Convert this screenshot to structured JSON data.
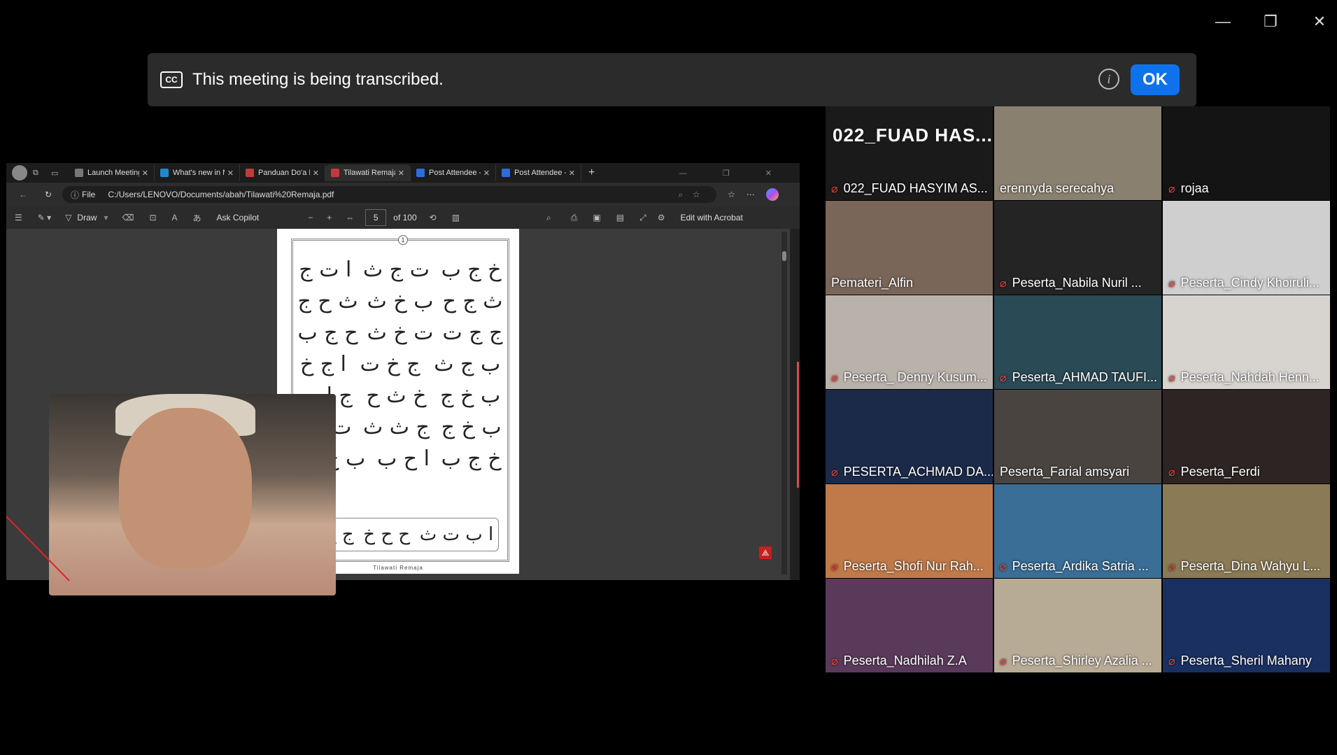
{
  "window": {
    "minimize": "—",
    "restore": "❐",
    "close": "✕"
  },
  "banner": {
    "cc": "CC",
    "text": "This meeting is being transcribed.",
    "info": "i",
    "ok": "OK"
  },
  "browser": {
    "tabs": [
      {
        "label": "Launch Meeting - Zo",
        "color": "#777"
      },
      {
        "label": "What's new in Micro",
        "color": "#1f8ad2"
      },
      {
        "label": "Panduan Do'a Pemb",
        "color": "#c43a3a"
      },
      {
        "label": "Tilawati Remaja.pdf",
        "color": "#c43a3a"
      },
      {
        "label": "Post Attendee - Zoo",
        "color": "#2d6cdf"
      },
      {
        "label": "Post Attendee - Zoo",
        "color": "#2d6cdf"
      }
    ],
    "new_tab": "+",
    "address_prefix": "File",
    "address": "C:/Users/LENOVO/Documents/abah/Tilawati%20Remaja.pdf",
    "pdf_toolbar": {
      "draw": "Draw",
      "ask_copilot": "Ask Copilot",
      "page": "5",
      "page_total": "of 100",
      "edit_acrobat": "Edit with Acrobat"
    },
    "page_number_badge": "1",
    "arabic_rows": [
      [
        "خ ج ب",
        "ت ج ث",
        "ا ت ج"
      ],
      [
        "ث ج ح",
        "ب خ ث",
        "ث ح ج"
      ],
      [
        "ج ج ت",
        "ت خ ث",
        "ح ج ب"
      ],
      [
        "ب ج ث",
        "ج خ ت",
        "ا ج خ"
      ],
      [
        "ب خ ج",
        "خ ث ح",
        "ج ا ب"
      ],
      [
        "ب خ ج",
        "ج ث ث",
        "ت ا خ"
      ],
      [
        "خ ج ب",
        "ا ح ب",
        "ب ح ث"
      ]
    ],
    "bottom_box": [
      "ا ب ت ث",
      "ح ح خ",
      "ج ح ح"
    ],
    "page_footer": "Tilawati Remaja"
  },
  "gallery": [
    {
      "name": "022_FUAD HASYIM AS...",
      "big": "022_FUAD  HAS...",
      "muted": true,
      "bg": "#1a1a1a"
    },
    {
      "name": "erennyda serecahya",
      "muted": false,
      "bg": "#8a8070"
    },
    {
      "name": "rojaa",
      "muted": true,
      "bg": "#141414"
    },
    {
      "name": "Pemateri_Alfin",
      "muted": false,
      "active": true,
      "bg": "#7a6658"
    },
    {
      "name": "Peserta_Nabila Nuril ...",
      "muted": true,
      "bg": "#242424"
    },
    {
      "name": "Peserta_Cindy Khoiruli...",
      "muted": true,
      "bg": "#cfcfcf"
    },
    {
      "name": "Peserta_ Denny Kusum...",
      "muted": true,
      "bg": "#b9b2aa"
    },
    {
      "name": "Peserta_AHMAD TAUFI...",
      "muted": true,
      "bg": "#2a4a55"
    },
    {
      "name": "Peserta_Nahdah Henn...",
      "muted": true,
      "bg": "#d7d4d0"
    },
    {
      "name": "PESERTA_ACHMAD DA...",
      "muted": true,
      "bg": "#1c2a4a"
    },
    {
      "name": "Peserta_Farial amsyari",
      "muted": false,
      "bg": "#4a4440"
    },
    {
      "name": "Peserta_Ferdi",
      "muted": true,
      "bg": "#2e2424"
    },
    {
      "name": "Peserta_Shofi Nur Rah...",
      "muted": true,
      "bg": "#c07a4a"
    },
    {
      "name": "Peserta_Ardika Satria ...",
      "muted": true,
      "bg": "#3a6e96"
    },
    {
      "name": "Peserta_Dina Wahyu L...",
      "muted": true,
      "bg": "#8a7a55"
    },
    {
      "name": "Peserta_Nadhilah Z.A",
      "muted": true,
      "bg": "#5a3a5a"
    },
    {
      "name": "Peserta_Shirley Azalia ...",
      "muted": true,
      "bg": "#b8ab96"
    },
    {
      "name": "Peserta_Sheril Mahany",
      "muted": true,
      "bg": "#1a3060"
    }
  ]
}
